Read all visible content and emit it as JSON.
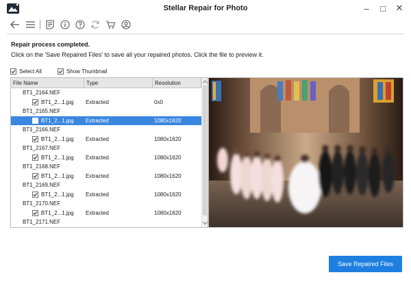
{
  "window": {
    "title": "Stellar Repair for Photo",
    "minimize_label": "–",
    "maximize_label": "□",
    "close_label": "✕"
  },
  "toolbar": {
    "icons": [
      "back-arrow-icon",
      "menu-icon",
      "document-icon",
      "info-icon",
      "help-icon",
      "refresh-icon",
      "cart-icon",
      "account-icon"
    ]
  },
  "status": {
    "title": "Repair process completed.",
    "description": "Click on the 'Save Repaired Files' to save all your repaired photos. Click the file to preview it."
  },
  "options": {
    "select_all": {
      "label": "Select All",
      "checked": true
    },
    "show_thumbnail": {
      "label": "Show Thumbnail",
      "checked": true
    }
  },
  "table": {
    "columns": [
      "File Name",
      "Type",
      "Resolution"
    ],
    "groups": [
      {
        "parent": "BT1_2164.NEF",
        "child": {
          "name": "BT1_2...1.jpg",
          "type": "Extracted",
          "resolution": "0x0",
          "selected": false
        }
      },
      {
        "parent": "BT1_2165.NEF",
        "child": {
          "name": "BT1_2...1.jpg",
          "type": "Extracted",
          "resolution": "1080x1620",
          "selected": true
        }
      },
      {
        "parent": "BT1_2166.NEF",
        "child": {
          "name": "BT1_2...1.jpg",
          "type": "Extracted",
          "resolution": "1080x1620",
          "selected": false
        }
      },
      {
        "parent": "BT1_2167.NEF",
        "child": {
          "name": "BT1_2...1.jpg",
          "type": "Extracted",
          "resolution": "1080x1620",
          "selected": false
        }
      },
      {
        "parent": "BT1_2168.NEF",
        "child": {
          "name": "BT1_2...1.jpg",
          "type": "Extracted",
          "resolution": "1080x1620",
          "selected": false
        }
      },
      {
        "parent": "BT1_2169.NEF",
        "child": {
          "name": "BT1_2...1.jpg",
          "type": "Extracted",
          "resolution": "1080x1620",
          "selected": false
        }
      },
      {
        "parent": "BT1_2170.NEF",
        "child": {
          "name": "BT1_2...1.jpg",
          "type": "Extracted",
          "resolution": "1080x1620",
          "selected": false
        }
      }
    ],
    "last_parent": "BT1_2171.NEF"
  },
  "actions": {
    "save_label": "Save Repaired Files"
  },
  "colors": {
    "accent": "#1e7fe0",
    "selection": "#3a87e0"
  }
}
